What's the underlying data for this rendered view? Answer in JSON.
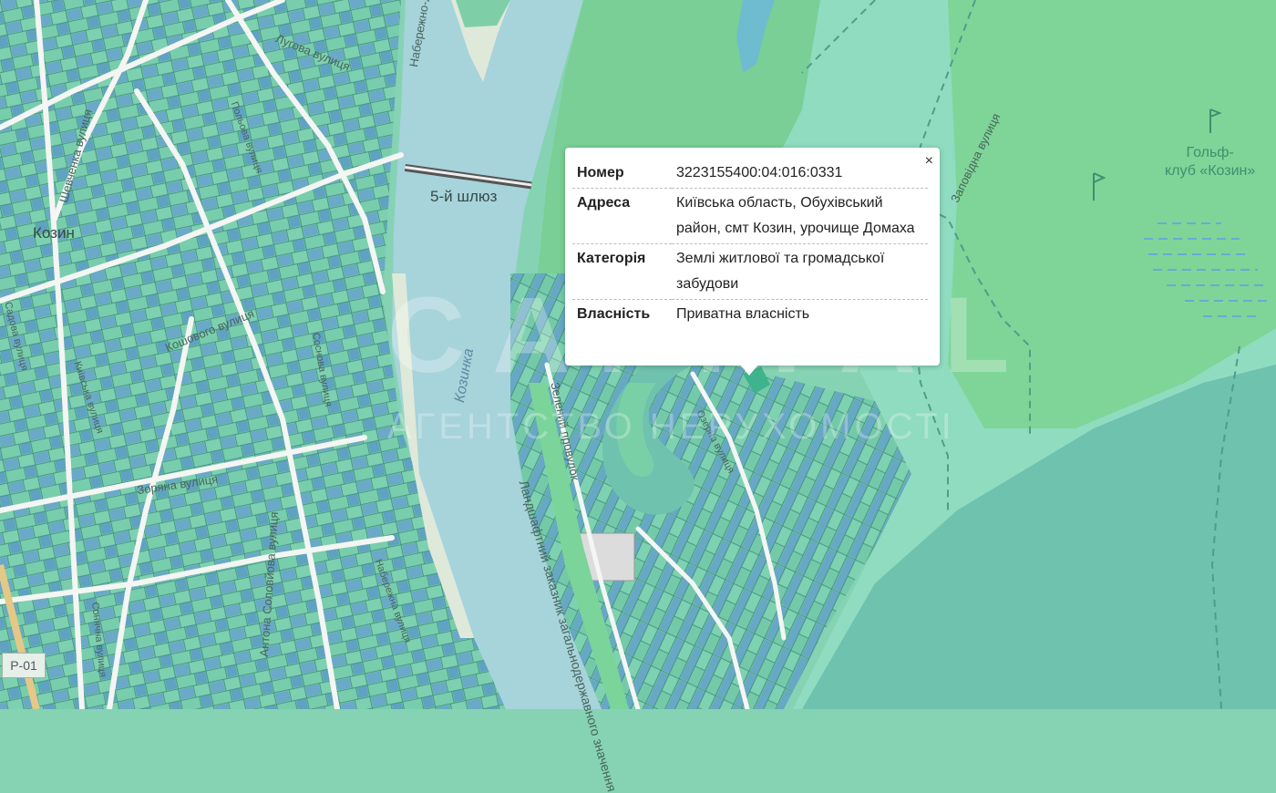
{
  "map": {
    "labels": {
      "town": "Козин",
      "lock": "5-й шлюз",
      "river": "Козинка",
      "golf_line1": "Гольф-",
      "golf_line2": "клуб «Козин»",
      "road_badge": "P-01"
    },
    "streets": [
      "Лугова вулиця",
      "Набережно-Лугова вулиця",
      "Шевченка вулиця",
      "Кошового вулиця",
      "Зоряна вулиця",
      "Антона Соловйова вулиця",
      "Заповідна вулиця",
      "Зелений провулок",
      "Ландшафтний заказник загальнодержавного значення",
      "Польова вулиця",
      "Садова вулиця",
      "Київська вулиця",
      "Набережна вулиця",
      "Соснова вулиця",
      "Сонячна вулиця",
      "Озерна вулиця"
    ],
    "watermark_line1": "CAPITAL",
    "watermark_line2": "АГЕНТСТВО НЕРУХОМОСТІ",
    "colors": {
      "land": "#86d3b3",
      "parcel": "#6fc7a6",
      "parcel_blue": "#6ca9c6",
      "water": "#a8d3dc",
      "park": "#7cd192",
      "road": "#f4f6f3"
    }
  },
  "popup": {
    "close_label": "×",
    "rows": [
      {
        "key": "Номер",
        "value": "3223155400:04:016:0331"
      },
      {
        "key": "Адреса",
        "value": "Київська область, Обухівський район, смт Козин, урочище Домаха"
      },
      {
        "key": "Категорія",
        "value": "Землі житлової та громадської забудови"
      },
      {
        "key": "Власність",
        "value": "Приватна власність"
      }
    ]
  }
}
